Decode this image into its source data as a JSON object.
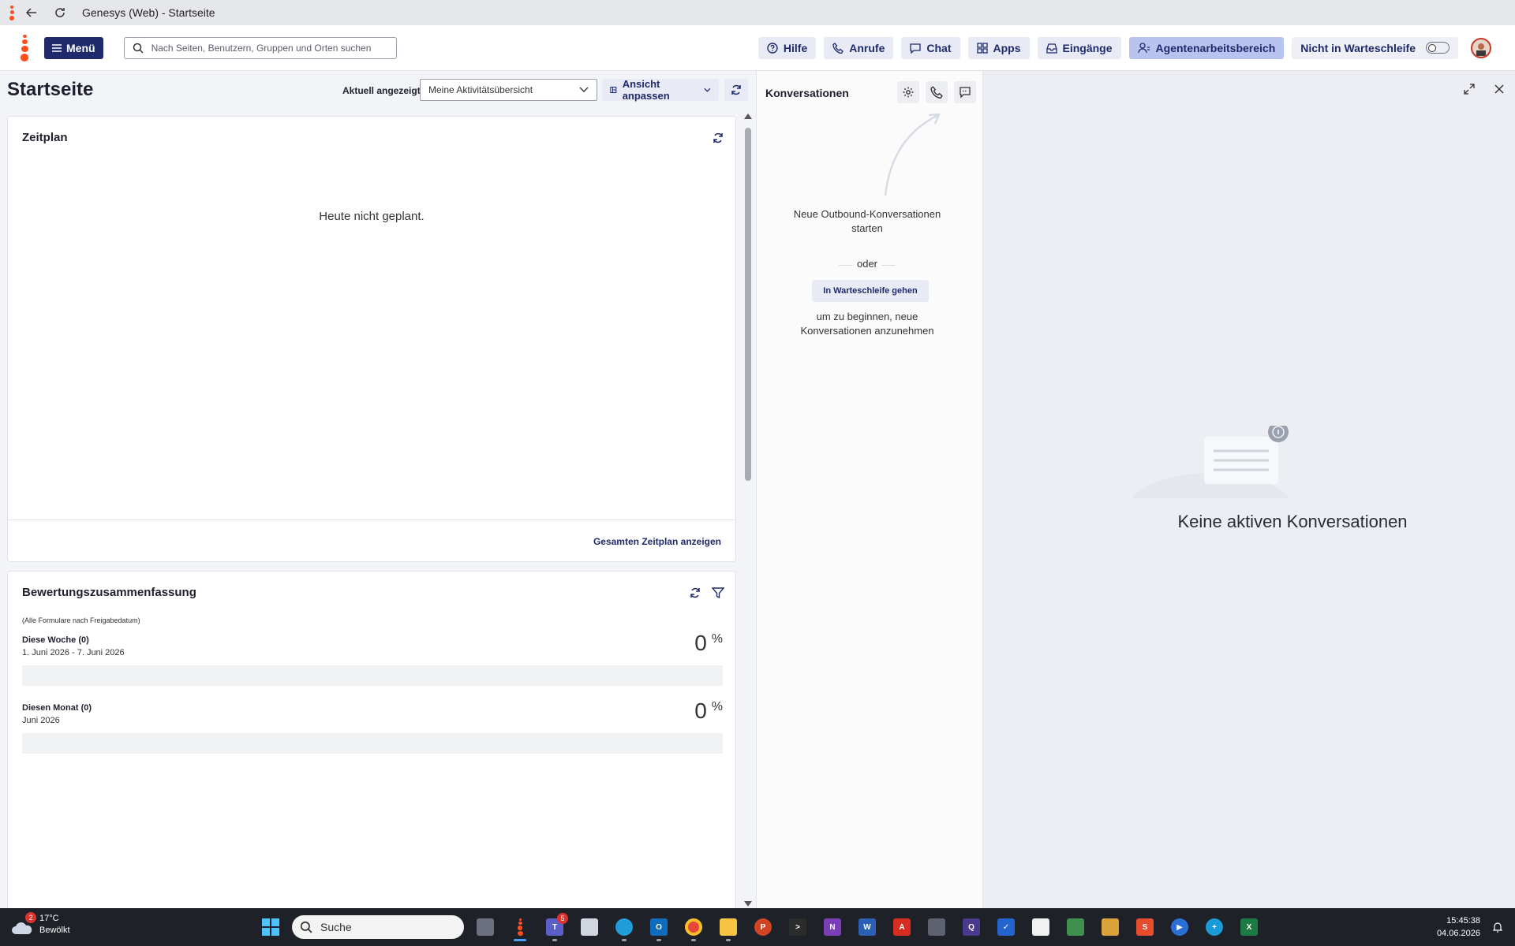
{
  "window": {
    "title": "Genesys (Web) - Startseite"
  },
  "topnav": {
    "menu_label": "Menü",
    "search_placeholder": "Nach Seiten, Benutzern, Gruppen und Orten suchen",
    "buttons": [
      {
        "label": "Hilfe",
        "icon": "help-circle-icon"
      },
      {
        "label": "Anrufe",
        "icon": "phone-icon"
      },
      {
        "label": "Chat",
        "icon": "chat-bubble-icon"
      },
      {
        "label": "Apps",
        "icon": "apps-grid-icon"
      },
      {
        "label": "Eingänge",
        "icon": "inbox-icon"
      },
      {
        "label": "Agentenarbeitsbereich",
        "icon": "agent-icon",
        "active": true
      }
    ],
    "status_label": "Nicht in Warteschleife",
    "accent_color": "#1f2a6b",
    "brand_color": "#ff4f1f"
  },
  "home": {
    "title": "Startseite",
    "view_label": "Aktuell angezeigt",
    "view_value": "Meine Aktivitätsübersicht",
    "adjust_label": "Ansicht anpassen",
    "schedule": {
      "title": "Zeitplan",
      "empty_text": "Heute nicht geplant.",
      "link": "Gesamten Zeitplan anzeigen"
    },
    "evaluation": {
      "title": "Bewertungszusammenfassung",
      "subtitle": "(Alle Formulare nach Freigabedatum)",
      "metrics": [
        {
          "label": "Diese Woche (0)",
          "range": "1. Juni 2026 - 7. Juni 2026",
          "value": "0",
          "unit": "%"
        },
        {
          "label": "Diesen Monat (0)",
          "range": "Juni 2026",
          "value": "0",
          "unit": "%"
        }
      ]
    }
  },
  "conversations": {
    "title": "Konversationen",
    "hint_top": "Neue Outbound-Konversationen starten",
    "or_text": "oder",
    "queue_button": "In Warteschleife gehen",
    "hint_bottom": "um zu beginnen, neue Konversationen anzunehmen"
  },
  "detail": {
    "empty_title": "Keine aktiven Konversationen"
  },
  "taskbar": {
    "weather_badge": "2",
    "temperature": "17°C",
    "weather": "Bewölkt",
    "search_label": "Suche",
    "teams_badge": "5",
    "time": "15:45:38",
    "date": "04.06.2026"
  }
}
